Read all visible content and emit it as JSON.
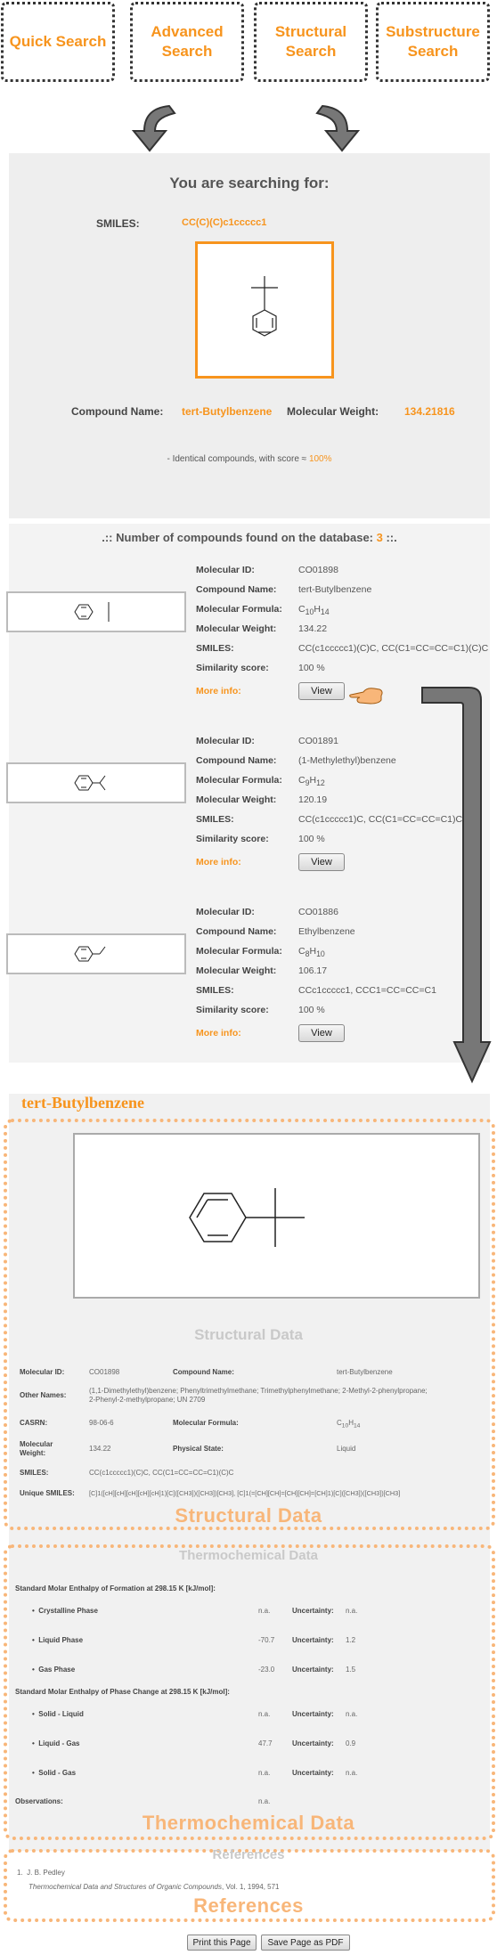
{
  "tabs": [
    {
      "line1": "Quick Search",
      "line2": ""
    },
    {
      "line1": "Advanced",
      "line2": "Search"
    },
    {
      "line1": "Structural",
      "line2": "Search"
    },
    {
      "line1": "Substructure",
      "line2": "Search"
    }
  ],
  "query": {
    "title": "You are searching for:",
    "smiles_label": "SMILES:",
    "smiles_value": "CC(C)(C)c1ccccc1",
    "compound_name_label": "Compound Name:",
    "compound_name_value": "tert-Butylbenzene",
    "mol_weight_label": "Molecular Weight:",
    "mol_weight_value": "134.21816",
    "identical_text": "- Identical compounds, with score ≈ ",
    "identical_pct": "100%"
  },
  "results": {
    "count_prefix": ".:: Number of compounds found on the database: ",
    "count": "3",
    "count_suffix": " ::.",
    "labels": {
      "id": "Molecular ID:",
      "name": "Compound Name:",
      "formula": "Molecular Formula:",
      "weight": "Molecular Weight:",
      "smiles": "SMILES:",
      "similarity": "Similarity score:",
      "more": "More info:",
      "view": "View"
    },
    "items": [
      {
        "id": "CO01898",
        "name": "tert-Butylbenzene",
        "formula_c": "C",
        "formula_c_sub": "10",
        "formula_h": "H",
        "formula_h_sub": "14",
        "weight": "134.22",
        "smiles": "CC(c1ccccc1)(C)C, CC(C1=CC=CC=C1)(C)C",
        "similarity": "100 %"
      },
      {
        "id": "CO01891",
        "name": "(1-Methylethyl)benzene",
        "formula_c": "C",
        "formula_c_sub": "9",
        "formula_h": "H",
        "formula_h_sub": "12",
        "weight": "120.19",
        "smiles": "CC(c1ccccc1)C, CC(C1=CC=CC=C1)C",
        "similarity": "100 %"
      },
      {
        "id": "CO01886",
        "name": "Ethylbenzene",
        "formula_c": "C",
        "formula_c_sub": "8",
        "formula_h": "H",
        "formula_h_sub": "10",
        "weight": "106.17",
        "smiles": "CCc1ccccc1, CCC1=CC=CC=C1",
        "similarity": "100 %"
      }
    ]
  },
  "compound": {
    "title": "tert-Butylbenzene",
    "structural_heading": "Structural Data",
    "structural": {
      "mol_id_label": "Molecular ID:",
      "mol_id": "CO01898",
      "name_label": "Compound Name:",
      "name": "tert-Butylbenzene",
      "other_label": "Other Names:",
      "other_1": "(1,1-Dimethylethyl)benzene; Phenyltrimethylmethane; Trimethylphenylmethane; 2-Methyl-2-phenylpropane;",
      "other_2": "2-Phenyl-2-methylpropane; UN 2709",
      "casrn_label": "CASRN:",
      "casrn": "98-06-6",
      "formula_label": "Molecular Formula:",
      "formula": "C",
      "formula_sub1": "10",
      "formula_h": "H",
      "formula_sub2": "14",
      "weight_label_1": "Molecular",
      "weight_label_2": "Weight:",
      "weight": "134.22",
      "state_label": "Physical State:",
      "state": "Liquid",
      "smiles_label": "SMILES:",
      "smiles": "CC(c1ccccc1)(C)C, CC(C1=CC=CC=C1)(C)C",
      "usmiles_label": "Unique SMILES:",
      "usmiles": "[C]1([cH][cH][cH][cH][cH]1)[C]([CH3])([CH3])[CH3], [C]1(=[CH][CH]=[CH][CH]=[CH]1)[C]([CH3])([CH3])[CH3]"
    },
    "structural_label": "Structural Data",
    "thermo_heading": "Thermochemical Data",
    "thermo": {
      "formation_title": "Standard Molar Enthalpy of Formation at 298.15 K [kJ/mol]:",
      "formation": [
        {
          "phase": "Crystalline Phase",
          "value": "n.a.",
          "unc": "n.a."
        },
        {
          "phase": "Liquid Phase",
          "value": "-70.7",
          "unc": "1.2"
        },
        {
          "phase": "Gas Phase",
          "value": "-23.0",
          "unc": "1.5"
        }
      ],
      "change_title": "Standard Molar Enthalpy of Phase Change at 298.15 K [kJ/mol]:",
      "change": [
        {
          "phase": "Solid - Liquid",
          "value": "n.a.",
          "unc": "n.a."
        },
        {
          "phase": "Liquid - Gas",
          "value": "47.7",
          "unc": "0.9"
        },
        {
          "phase": "Solid - Gas",
          "value": "n.a.",
          "unc": "n.a."
        }
      ],
      "unc_label": "Uncertainty:",
      "obs_label": "Observations:",
      "obs_value": "n.a."
    },
    "thermo_label": "Thermochemical Data",
    "refs_heading": "References",
    "ref_num": "1.",
    "ref_author": "J. B. Pedley",
    "ref_title": "Thermochemical Data and Structures of Organic Compounds",
    "ref_rest": ", Vol. 1, 1994, 571",
    "refs_label": "References"
  },
  "buttons": {
    "print": "Print this Page",
    "pdf": "Save Page as PDF"
  },
  "colors": {
    "accent": "#f7941d",
    "accent_light": "#f8b679",
    "panel": "#eeeeee"
  }
}
